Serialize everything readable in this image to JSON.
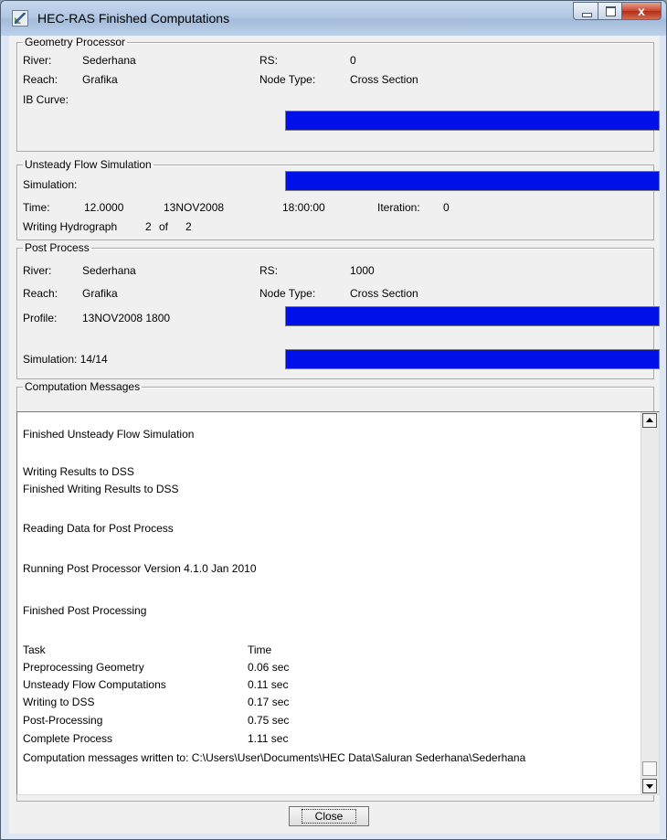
{
  "window": {
    "title": "HEC-RAS Finished Computations",
    "close_glyph": "x"
  },
  "geometry": {
    "legend": "Geometry Processor",
    "river_label": "River:",
    "river": "Sederhana",
    "rs_label": "RS:",
    "rs": "0",
    "reach_label": "Reach:",
    "reach": "Grafika",
    "node_type_label": "Node Type:",
    "node_type": "Cross Section",
    "ib_curve_label": "IB Curve:",
    "ib_curve_progress": 1.0
  },
  "unsteady": {
    "legend": "Unsteady Flow Simulation",
    "simulation_label": "Simulation:",
    "simulation_progress": 1.0,
    "time_label": "Time:",
    "time_value": "12.0000",
    "date": "13NOV2008",
    "clock": "18:00:00",
    "iteration_label": "Iteration:",
    "iteration": "0",
    "writing_label": "Writing Hydrograph",
    "writing_current": "2",
    "writing_of": "of",
    "writing_total": "2"
  },
  "post": {
    "legend": "Post Process",
    "river_label": "River:",
    "river": "Sederhana",
    "rs_label": "RS:",
    "rs": "1000",
    "reach_label": "Reach:",
    "reach": "Grafika",
    "node_type_label": "Node Type:",
    "node_type": "Cross Section",
    "profile_label": "Profile:",
    "profile": "13NOV2008 1800",
    "profile_progress": 1.0,
    "simulation_label": "Simulation: 14/14",
    "simulation_progress": 1.0
  },
  "messages": {
    "legend": "Computation Messages",
    "lines": [
      "Finished Unsteady Flow Simulation",
      "Writing Results to DSS",
      "Finished Writing Results to DSS",
      "Reading Data for Post Process",
      "Running Post Processor  Version 4.1.0 Jan 2010",
      "Finished Post Processing"
    ],
    "table_header": {
      "task": "Task",
      "time": "Time"
    },
    "tasks": [
      {
        "task": "Preprocessing Geometry",
        "time": "0.06 sec"
      },
      {
        "task": "Unsteady Flow Computations",
        "time": "0.11 sec"
      },
      {
        "task": "Writing to DSS",
        "time": "0.17 sec"
      },
      {
        "task": "Post-Processing",
        "time": "0.75 sec"
      },
      {
        "task": "Complete Process",
        "time": "1.11 sec"
      }
    ],
    "footer": "Computation messages written to: C:\\Users\\User\\Documents\\HEC Data\\Saluran Sederhana\\Sederhana"
  },
  "buttons": {
    "close": "Close"
  }
}
